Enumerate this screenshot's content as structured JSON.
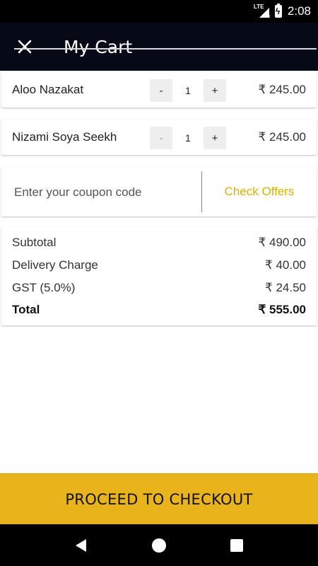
{
  "status_bar": {
    "time": "2:08",
    "network": "LTE"
  },
  "header": {
    "title": "My Cart"
  },
  "items": [
    {
      "name": "Aloo Nazakat",
      "quantity": "1",
      "minus": "-",
      "plus": "+",
      "price": "₹ 245.00"
    },
    {
      "name": "Nizami Soya Seekh",
      "quantity": "1",
      "minus": "-",
      "plus": "+",
      "price": "₹ 245.00"
    }
  ],
  "coupon": {
    "placeholder": "Enter your coupon code",
    "check_offers": "Check Offers"
  },
  "summary": {
    "subtotal_label": "Subtotal",
    "subtotal_value": "₹ 490.00",
    "delivery_label": "Delivery Charge",
    "delivery_value": "₹ 40.00",
    "gst_label": "GST (5.0%)",
    "gst_value": "₹ 24.50",
    "total_label": "Total",
    "total_value": "₹ 555.00"
  },
  "checkout": {
    "label": "PROCEED TO CHECKOUT"
  },
  "colors": {
    "accent": "#e8b31b",
    "app_bar": "#060a16",
    "offers_text": "#e1b000"
  },
  "icons": {
    "close": "close-icon",
    "back": "back-triangle-icon",
    "home": "home-circle-icon",
    "recents": "recents-square-icon"
  }
}
